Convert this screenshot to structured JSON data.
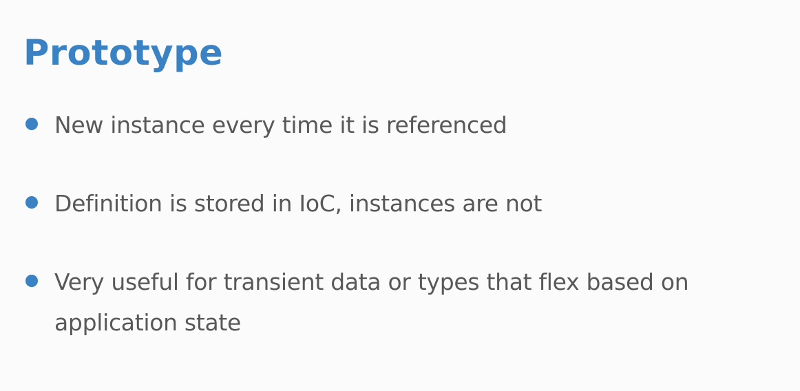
{
  "slide": {
    "title": "Prototype",
    "bullets": [
      "New instance every time it is referenced",
      "Definition is stored in IoC, instances are not",
      "Very useful for transient data or types that flex based on application state"
    ]
  },
  "colors": {
    "accent": "#3b82c4",
    "text": "#585858",
    "background": "#fbfbfb"
  }
}
